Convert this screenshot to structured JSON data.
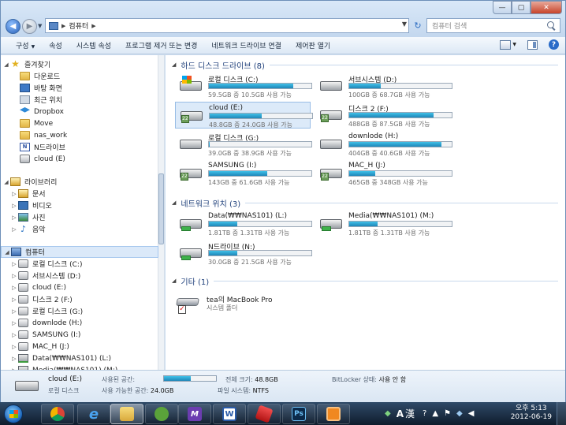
{
  "window": {
    "address": "컴퓨터",
    "search_placeholder": "컴퓨터 검색",
    "controls": {
      "minimize": "—",
      "maximize": "▢",
      "close": "✕"
    }
  },
  "toolbar": {
    "organize": "구성",
    "properties": "속성",
    "system_properties": "시스템 속성",
    "uninstall": "프로그램 제거 또는 변경",
    "map_drive": "네트워크 드라이브 연결",
    "control_panel": "제어판 열기"
  },
  "nav": {
    "favorites": {
      "title": "즐겨찾기",
      "items": [
        "다운로드",
        "바탕 화면",
        "최근 위치",
        "Dropbox",
        "Move",
        "nas_work",
        "N드라이브",
        "cloud (E)"
      ]
    },
    "libraries": {
      "title": "라이브러리",
      "items": [
        "문서",
        "비디오",
        "사진",
        "음악"
      ]
    },
    "computer": {
      "title": "컴퓨터",
      "items": [
        "로컬 디스크 (C:)",
        "서브시스템 (D:)",
        "cloud (E:)",
        "디스크 2 (F:)",
        "로컬 디스크 (G:)",
        "downlode (H:)",
        "SAMSUNG (I:)",
        "MAC_H (J:)",
        "Data(₩₩NAS101) (L:)",
        "Media(₩₩NAS101) (M:)"
      ]
    }
  },
  "groups": {
    "hdd": "하드 디스크 드라이브 (8)",
    "network": "네트워크 위치 (3)",
    "other": "기타 (1)"
  },
  "drives": [
    {
      "name": "로컬 디스크 (C:)",
      "info": "59.5GB 중 10.5GB 사용 가능",
      "used": 0.82
    },
    {
      "name": "서브시스템 (D:)",
      "info": "100GB 중 68.7GB 사용 가능",
      "used": 0.31
    },
    {
      "name": "cloud (E:)",
      "info": "48.8GB 중 24.0GB 사용 가능",
      "used": 0.51
    },
    {
      "name": "디스크 2 (F:)",
      "info": "488GB 중 87.5GB 사용 가능",
      "used": 0.82
    },
    {
      "name": "로컬 디스크 (G:)",
      "info": "39.0GB 중 38.9GB 사용 가능",
      "used": 0.01
    },
    {
      "name": "downlode (H:)",
      "info": "404GB 중 40.6GB 사용 가능",
      "used": 0.9
    },
    {
      "name": "SAMSUNG (I:)",
      "info": "143GB 중 61.6GB 사용 가능",
      "used": 0.57
    },
    {
      "name": "MAC_H (J:)",
      "info": "465GB 중 348GB 사용 가능",
      "used": 0.25
    }
  ],
  "network_drives": [
    {
      "name": "Data(₩₩NAS101) (L:)",
      "info": "1.81TB 중 1.31TB 사용 가능",
      "used": 0.28
    },
    {
      "name": "Media(₩₩NAS101) (M:)",
      "info": "1.81TB 중 1.31TB 사용 가능",
      "used": 0.28
    },
    {
      "name": "N드라이브 (N:)",
      "info": "30.0GB 중 21.5GB 사용 가능",
      "used": 0.28
    }
  ],
  "other_items": [
    {
      "name": "tea의 MacBook Pro",
      "sub": "시스템 폴더"
    }
  ],
  "details": {
    "name": "cloud (E:)",
    "type": "로컬 디스크",
    "used_label": "사용된 공간:",
    "used": 0.51,
    "free_label": "사용 가능한 공간:",
    "free_value": "24.0GB",
    "total_label": "전체 크기:",
    "total_value": "48.8GB",
    "fs_label": "파일 시스템:",
    "fs_value": "NTFS",
    "bitlocker_label": "BitLocker 상태:",
    "bitlocker_value": "사용 안 함"
  },
  "taskbar": {
    "apps": [
      "chrome",
      "internet-explorer",
      "windows-explorer",
      "evernote",
      "m-app",
      "word",
      "red-app",
      "photoshop",
      "vmware"
    ],
    "ime_a": "A",
    "ime_h": "漢",
    "time": "오후 5:13",
    "date": "2012-06-19"
  },
  "colors": {
    "bar_fill": "#1e86b8",
    "selection": "#dceaf9",
    "group_header": "#1e3f7a"
  }
}
